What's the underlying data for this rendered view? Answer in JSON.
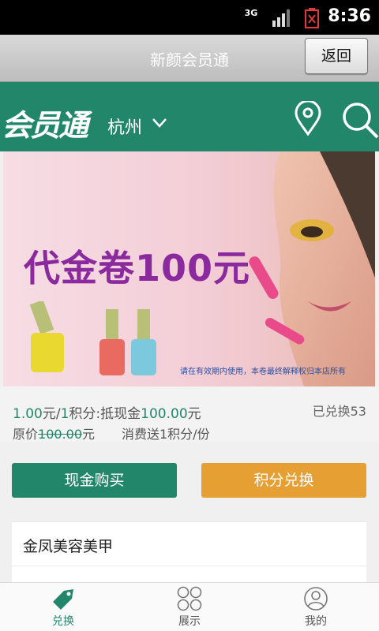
{
  "status_bar": {
    "network": "3G",
    "time": "8:36"
  },
  "title_bar": {
    "title": "新颜会员通",
    "back_label": "返回"
  },
  "header": {
    "logo_text": "会员通",
    "city": "杭州",
    "icons": [
      "location-pin-icon",
      "search-icon"
    ]
  },
  "banner": {
    "headline": "代金卷100元",
    "note": "请在有效期内使用，本卷最终解释权归本店所有"
  },
  "offer": {
    "price": "1.00",
    "price_unit": "元/",
    "points": "1",
    "points_unit": "积分:抵现金",
    "cash_value": "100.00",
    "cash_unit": "元",
    "exchanged": "已兑换53",
    "orig_label": "原价",
    "orig_price": "100.00",
    "orig_unit": "元",
    "gift": "消费送1积分/份"
  },
  "actions": {
    "cash_buy": "现金购买",
    "points_exchange": "积分兑换"
  },
  "store": {
    "name": "金凤美容美甲"
  },
  "bottom_nav": {
    "items": [
      {
        "label": "兑换",
        "icon": "tag-icon",
        "active": true
      },
      {
        "label": "展示",
        "icon": "grid-circles-icon",
        "active": false
      },
      {
        "label": "我的",
        "icon": "user-icon",
        "active": false
      }
    ]
  },
  "colors": {
    "brand_green": "#22876a",
    "accent_orange": "#e59f32",
    "banner_purple": "#8a2a9e"
  }
}
